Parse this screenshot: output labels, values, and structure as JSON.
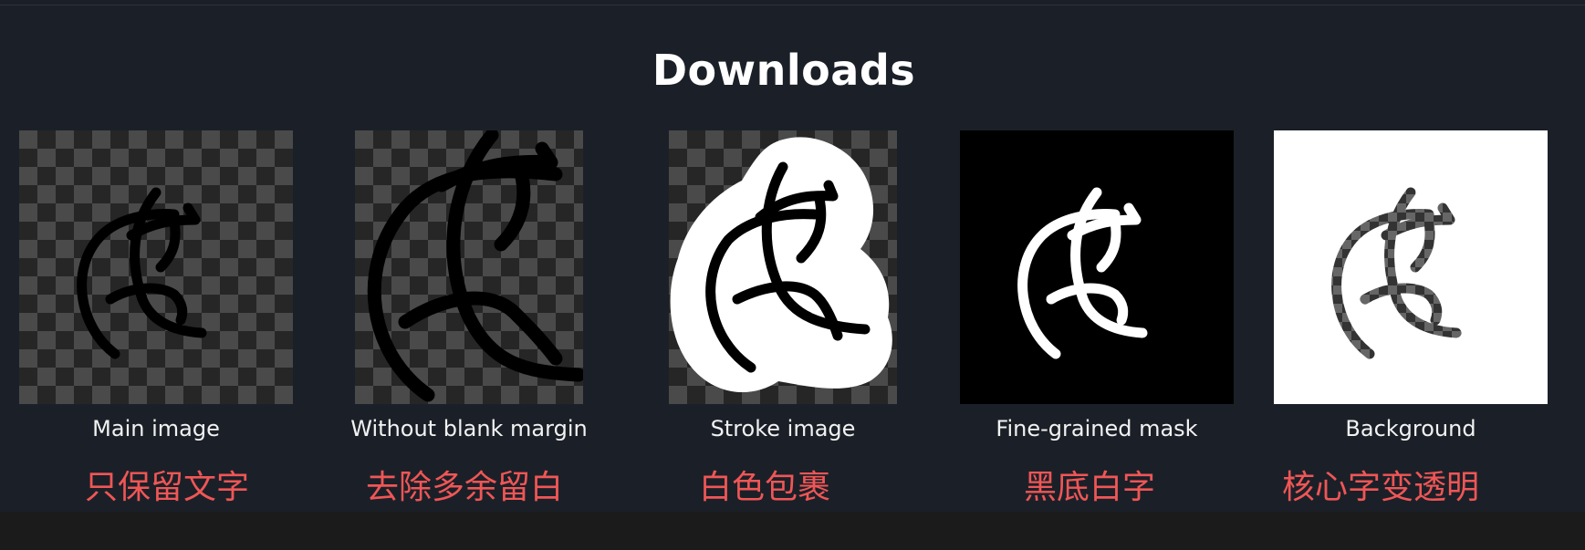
{
  "page": {
    "title": "Downloads"
  },
  "items": [
    {
      "caption": "Main image",
      "note": "只保留文字",
      "background": "checkerboard",
      "icon": "handwritten-glyph"
    },
    {
      "caption": "Without blank margin",
      "note": "去除多余留白",
      "background": "checkerboard",
      "icon": "handwritten-glyph"
    },
    {
      "caption": "Stroke image",
      "note": "白色包裹",
      "background": "checkerboard",
      "icon": "handwritten-glyph"
    },
    {
      "caption": "Fine-grained mask",
      "note": "黑底白字",
      "background": "black",
      "icon": "handwritten-glyph"
    },
    {
      "caption": "Background",
      "note": "核心字变透明",
      "background": "white",
      "icon": "handwritten-glyph"
    }
  ],
  "colors": {
    "page_background": "#1b2028",
    "title": "#ffffff",
    "caption": "#f2f2f2",
    "note": "#f05656"
  }
}
